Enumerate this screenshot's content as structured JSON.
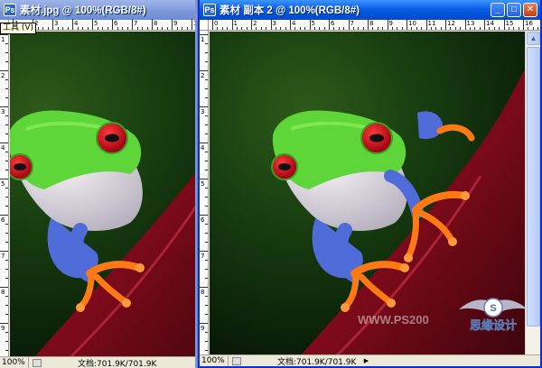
{
  "left_window": {
    "title": "素材.jpg @ 100%(RGB/8#)",
    "tooltip": "工具 (V)",
    "zoom": "100%",
    "doc_info": "文档:701.9K/701.9K",
    "ruler_h_labels": [
      "1",
      "2",
      "3",
      "4",
      "5",
      "6",
      "7",
      "8",
      "9",
      "10"
    ],
    "ruler_v_labels": [
      "1",
      "2",
      "3",
      "4",
      "5",
      "6",
      "7",
      "8",
      "9"
    ]
  },
  "right_window": {
    "title": "素材 副本 2 @ 100%(RGB/8#)",
    "zoom": "100%",
    "doc_info": "文档:701.9K/701.9K",
    "ruler_h_labels": [
      "0",
      "1",
      "2",
      "3",
      "4",
      "5",
      "6",
      "7",
      "8",
      "9",
      "10",
      "11",
      "12",
      "13",
      "14",
      "15",
      "16"
    ],
    "ruler_v_labels": [
      "1",
      "2",
      "3",
      "4",
      "5",
      "6",
      "7",
      "8",
      "9"
    ]
  },
  "watermark": {
    "url_text": "WWW.PS200",
    "badge_text": "思缘设计"
  },
  "colors": {
    "active_title": "#0a5ee6",
    "inactive_title": "#7b97d9",
    "window_face": "#ece9d8",
    "frog_green": "#5ed63a",
    "frog_eye": "#c8101a",
    "frog_toes": "#ff7a14",
    "leaf_red": "#8a0f1e"
  },
  "icons": {
    "document": "ps-document-icon",
    "minimize": "minimize-icon",
    "maximize": "maximize-icon",
    "close": "close-icon"
  }
}
